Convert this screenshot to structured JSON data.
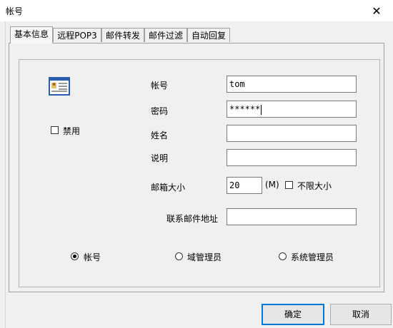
{
  "window": {
    "title": "帐号",
    "close_glyph": "✕"
  },
  "tabs": [
    {
      "label": "基本信息",
      "active": true
    },
    {
      "label": "远程POP3",
      "active": false
    },
    {
      "label": "邮件转发",
      "active": false
    },
    {
      "label": "邮件过滤",
      "active": false
    },
    {
      "label": "自动回复",
      "active": false
    }
  ],
  "form": {
    "disable_label": "禁用",
    "account_label": "帐号",
    "account_value": "tom",
    "password_label": "密码",
    "password_value": "******",
    "name_label": "姓名",
    "name_value": "",
    "desc_label": "说明",
    "desc_value": "",
    "mailbox_size_label": "邮箱大小",
    "mailbox_size_value": "20",
    "mailbox_unit": "(M)",
    "unlimited_label": "不限大小",
    "contact_label": "联系邮件地址",
    "contact_value": ""
  },
  "roles": {
    "selected": "account",
    "account_label": "帐号",
    "domain_admin_label": "域管理员",
    "system_admin_label": "系统管理员"
  },
  "buttons": {
    "ok_label": "确定",
    "cancel_label": "取消"
  },
  "icons": {
    "close": "close-icon",
    "user_card": "user-card-icon"
  },
  "colors": {
    "accent": "#0078d7"
  }
}
